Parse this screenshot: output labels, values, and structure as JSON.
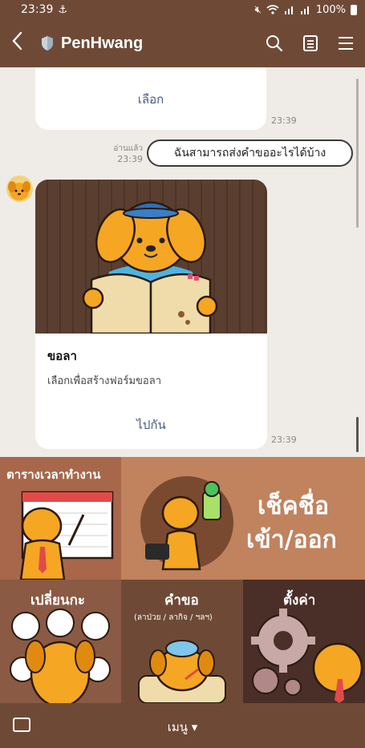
{
  "status": {
    "time": "23:39",
    "battery": "100%"
  },
  "header": {
    "title": "PenHwang"
  },
  "chat": {
    "top_bubble_link": "เลือก",
    "top_bubble_time": "23:39",
    "read_label": "อ่านแล้ว",
    "user_time": "23:39",
    "user_message": "ฉันสามารถส่งคำขออะไรได้บ้าง",
    "card": {
      "title": "ขอลา",
      "description": "เลือกเพื่อสร้างฟอร์มขอลา",
      "action": "ไปกัน",
      "time": "23:39"
    }
  },
  "rich_menu": {
    "timetable": "ตารางเวลาทำงาน",
    "checkin_line1": "เช็คชื่อ",
    "checkin_line2": "เข้า/ออก",
    "shift": "เปลี่ยนกะ",
    "request": "คำขอ",
    "request_sub": "(ลาป่วย / ลากิจ / ฯลฯ)",
    "settings": "ตั้งค่า"
  },
  "bottom": {
    "menu_label": "เมนู ▾"
  },
  "colors": {
    "brand": "#6e4a36",
    "chat_bg": "#efebe6",
    "link": "#4a5a8a",
    "dog": "#f5a623"
  }
}
